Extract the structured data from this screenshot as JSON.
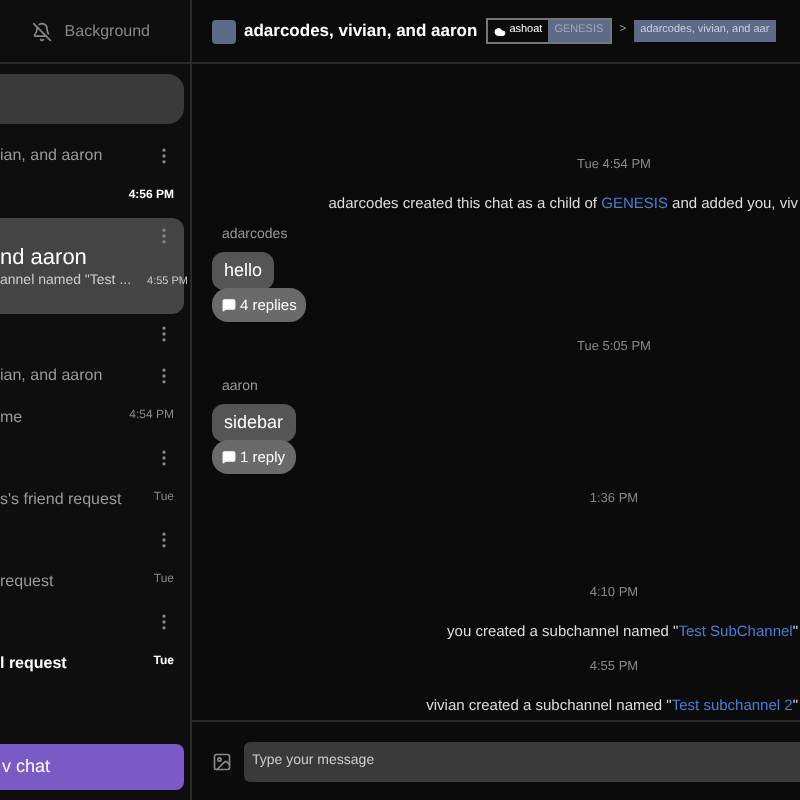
{
  "sidebar": {
    "tab": {
      "label": "Background"
    },
    "items": [
      {
        "kind": "line",
        "text": "ian, and aaron",
        "menu": true,
        "unread": false
      },
      {
        "kind": "line",
        "time": "4:56 PM",
        "menu": false,
        "unread": true
      },
      {
        "kind": "card",
        "selected": true,
        "title": "nd aaron",
        "text": "annel named \"Test ...",
        "time": "4:55 PM"
      },
      {
        "kind": "menu"
      },
      {
        "kind": "line",
        "text": "ian, and aaron",
        "menu": true,
        "unread": false
      },
      {
        "kind": "line",
        "text": "me",
        "time": "4:54 PM",
        "menu": false,
        "unread": false
      },
      {
        "kind": "menu"
      },
      {
        "kind": "line",
        "text": "s's friend request",
        "time": "Tue",
        "menu": false,
        "unread": false
      },
      {
        "kind": "menu"
      },
      {
        "kind": "line",
        "text": "request",
        "time": "Tue",
        "menu": false,
        "unread": false
      },
      {
        "kind": "menu"
      },
      {
        "kind": "line",
        "text": "l request",
        "time": "Tue",
        "menu": false,
        "unread": true
      }
    ],
    "new_chat_button": "v chat"
  },
  "header": {
    "title": "adarcodes, vivian, and aaron",
    "community": "ashoat",
    "parent": "GENESIS",
    "separator": ">",
    "current": "adarcodes, vivian, and aar"
  },
  "messages": [
    {
      "kind": "time",
      "text": "Tue 4:54 PM"
    },
    {
      "kind": "robot",
      "parts": [
        {
          "text": "adarcodes created this chat as a child of ",
          "link": false
        },
        {
          "text": "GENESIS",
          "link": true
        },
        {
          "text": " and added you, viv",
          "link": false
        }
      ]
    },
    {
      "kind": "message",
      "author": "adarcodes",
      "text": "hello",
      "replies": "4 replies"
    },
    {
      "kind": "time",
      "text": "Tue 5:05 PM"
    },
    {
      "kind": "message",
      "author": "aaron",
      "text": "sidebar",
      "replies": "1 reply"
    },
    {
      "kind": "time",
      "text": "1:36 PM"
    },
    {
      "kind": "gap"
    },
    {
      "kind": "time",
      "text": "4:10 PM"
    },
    {
      "kind": "robot",
      "parts": [
        {
          "text": "you created a subchannel named \"",
          "link": false
        },
        {
          "text": "Test SubChannel",
          "link": true
        },
        {
          "text": "\"",
          "link": false
        }
      ]
    },
    {
      "kind": "time",
      "text": "4:55 PM"
    },
    {
      "kind": "robot",
      "parts": [
        {
          "text": "vivian created a subchannel named \"",
          "link": false
        },
        {
          "text": "Test subchannel 2",
          "link": true
        },
        {
          "text": "\"",
          "link": false
        }
      ]
    }
  ],
  "composer": {
    "placeholder": "Type your message"
  }
}
